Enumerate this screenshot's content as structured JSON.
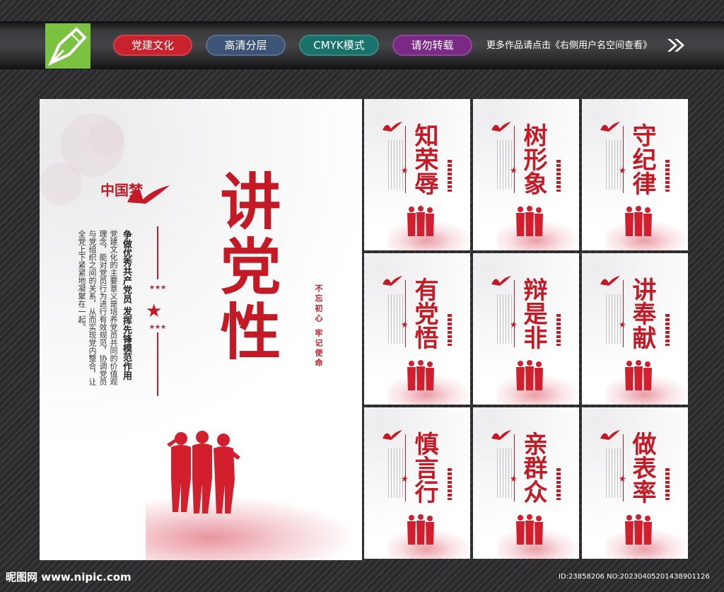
{
  "toolbar": {
    "tags": [
      "党建文化",
      "高清分层",
      "CMYK模式",
      "请勿转载"
    ],
    "note": "更多作品请点击《右侧用户名空间查看》"
  },
  "main_poster": {
    "title": "讲党性",
    "slogan": "争做优秀共产党员 发挥先锋模范作用",
    "body": "党建文化的主要意义是培养党员共同的价值观理念，能对党员行为进行有效规范，协调党员与党组织之间的关系，从而实现党内整合，让全党上下紧紧地凝聚在一起。",
    "motto": "不忘初心 牢记使命",
    "logo_text": "中国梦"
  },
  "posters": [
    {
      "title": "知荣辱"
    },
    {
      "title": "树形象"
    },
    {
      "title": "守纪律"
    },
    {
      "title": "有党悟"
    },
    {
      "title": "辩是非"
    },
    {
      "title": "讲奉献"
    },
    {
      "title": "慎言行"
    },
    {
      "title": "亲群众"
    },
    {
      "title": "做表率"
    }
  ],
  "footer": {
    "site": "昵图网 www.nipic.com",
    "id": "ID:23858206 NO:20230405201438901126"
  },
  "colors": {
    "accent": "#c41a25"
  }
}
